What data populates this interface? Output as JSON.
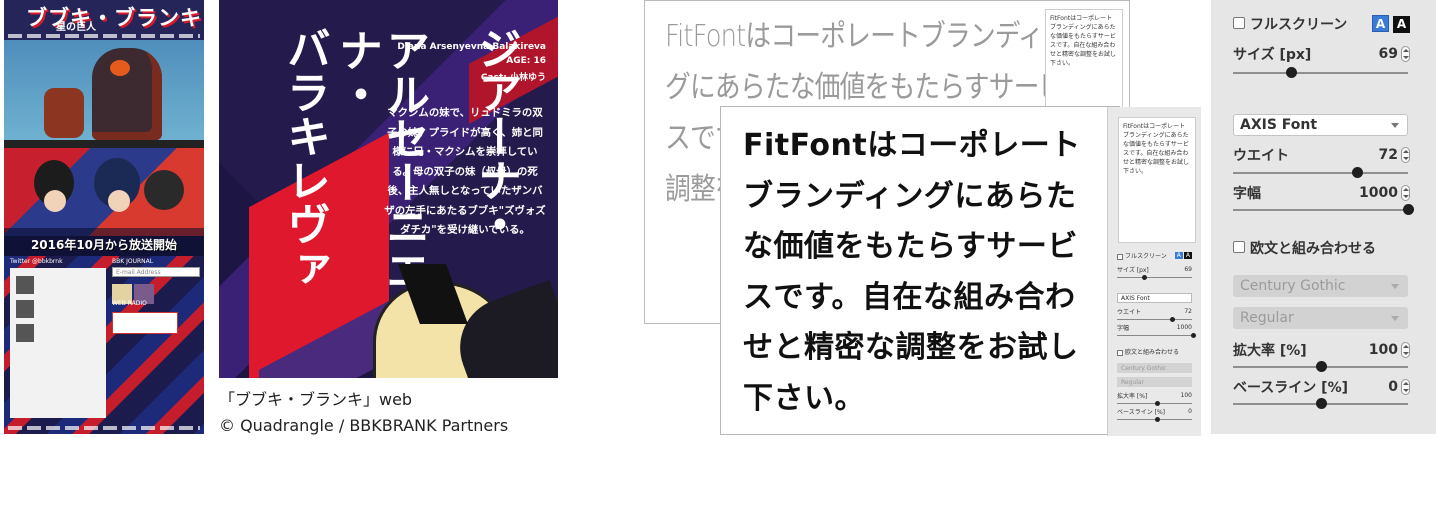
{
  "site": {
    "logo": "ブブキ・ブランキ",
    "logo_sub": "星の巨人",
    "date_banner": "2016年10月から放送開始",
    "twitter_label": "Twitter @bbkbrnk",
    "journal_label": "BBK JOURNAL",
    "email_placeholder": "E-mail Address",
    "radio_label": "WEB RADIO"
  },
  "poster": {
    "name_col1": "ジアーナ・",
    "name_col2": "アルセーニエヴナ・",
    "name_col3": "バラキレヴァ",
    "romanized": "Diana Arsenyevna Balakireva",
    "age": "AGE: 16",
    "cast": "Cast: 小林ゆう",
    "description": "マクシムの妹で、リュドミラの双子の妹。プライドが高く、姉と同様に兄・マクシムを崇拝している。母の双子の妹（叔母）の死後、主人無しとなっていたザンバザの左手にあたるブブキ\"ズヴォズダチカ\"を受け継いでいる。"
  },
  "caption": {
    "line1": "「ブブキ・ブランキ」web",
    "line2": "© Quadrangle / BBKBRANK Partners"
  },
  "back_window": {
    "text": [
      "FitFontはコーポレートブランディン",
      "グにあらたな価値をもたらすサービ",
      "スです。自在",
      "調整を"
    ],
    "mini": "FitFontはコーポレートブランディングにあらたな価値をもたらすサービスです。自在な組み合わせと精密な調整をお試し下さい。"
  },
  "front_window": {
    "text": "FitFontはコーポレートブランディングにあらたな価値をもたらすサービスです。自在な組み合わせと精密な調整をお試し下さい。",
    "mini": "FitFontはコーポレートブランディングにあらたな価値をもたらすサービスです。自在な組み合わせと精密な調整をお試し下さい。",
    "fullscreen": "フルスクリーン",
    "size_label": "サイズ [px]",
    "size_value": "69",
    "font": "AXIS Font",
    "weight_label": "ウエイト",
    "weight_value": "72",
    "width_label": "字幅",
    "width_value": "1000",
    "combine_label": "欧文と組み合わせる",
    "latin_font": "Century Gothic",
    "latin_style": "Regular",
    "scale_label": "拡大率 [%]",
    "scale_value": "100",
    "baseline_label": "ベースライン [%]",
    "baseline_value": "0"
  },
  "panel": {
    "fullscreen_label": "フルスクリーン",
    "btn_a1": "A",
    "btn_a2": "A",
    "size_label": "サイズ [px]",
    "size_value": "69",
    "size_level": 0.33,
    "font_select": "AXIS Font",
    "weight_label": "ウエイト",
    "weight_value": "72",
    "weight_level": 0.71,
    "width_label": "字幅",
    "width_value": "1000",
    "width_level": 1.0,
    "combine_label": "欧文と組み合わせる",
    "latin_font_select": "Century Gothic",
    "latin_style_select": "Regular",
    "scale_label": "拡大率 [%]",
    "scale_value": "100",
    "scale_level": 0.5,
    "baseline_label": "ベースライン [%]",
    "baseline_value": "0",
    "baseline_level": 0.5
  },
  "colors": {
    "panel_bg": "#e6e6e6",
    "accent_blue": "#3a7ad8",
    "poster_bg": "#251a4c",
    "poster_red": "#e0182d"
  }
}
